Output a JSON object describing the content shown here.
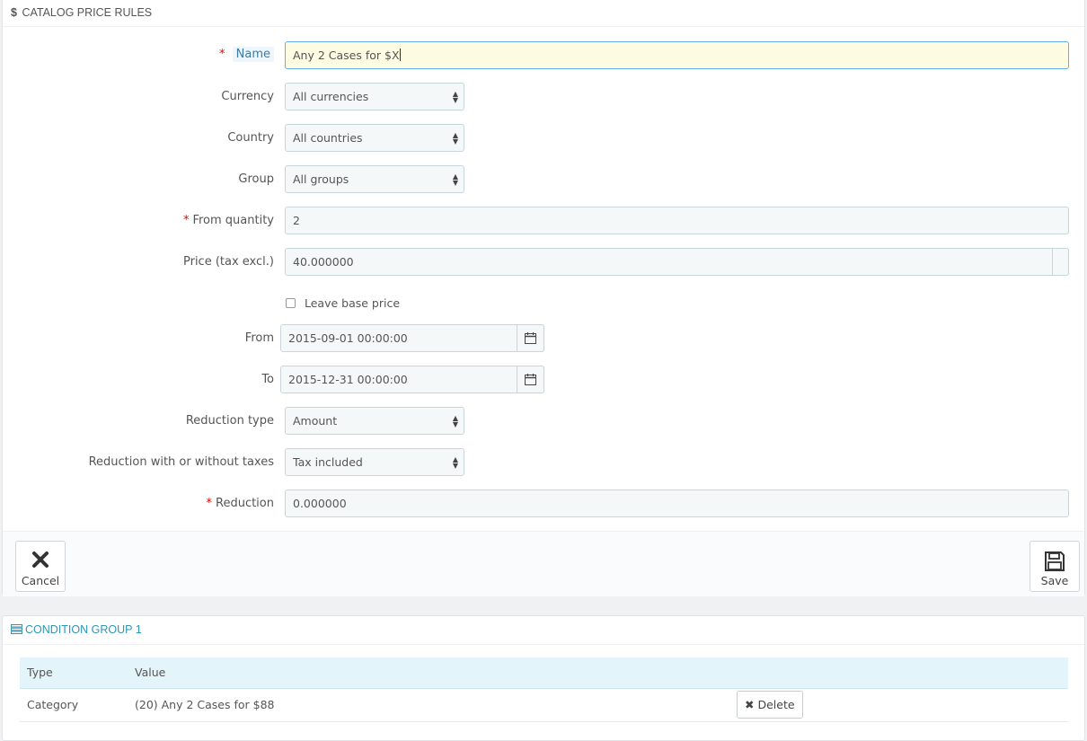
{
  "panel": {
    "title": "Catalog price rules",
    "icon": "dollar-icon"
  },
  "form": {
    "name": {
      "label": "Name",
      "value": "Any 2 Cases for $X",
      "required": true
    },
    "currency": {
      "label": "Currency",
      "value": "All currencies"
    },
    "country": {
      "label": "Country",
      "value": "All countries"
    },
    "group": {
      "label": "Group",
      "value": "All groups"
    },
    "from_quantity": {
      "label": "From quantity",
      "value": "2",
      "required": true
    },
    "price": {
      "label": "Price (tax excl.)",
      "value": "40.000000"
    },
    "leave_base_price": {
      "label": "Leave base price",
      "checked": false
    },
    "from": {
      "label": "From",
      "value": "2015-09-01 00:00:00"
    },
    "to": {
      "label": "To",
      "value": "2015-12-31 00:00:00"
    },
    "reduction_type": {
      "label": "Reduction type",
      "value": "Amount"
    },
    "reduction_tax": {
      "label": "Reduction with or without taxes",
      "value": "Tax included"
    },
    "reduction": {
      "label": "Reduction",
      "value": "0.000000",
      "required": true
    }
  },
  "footer": {
    "cancel_label": "Cancel",
    "save_label": "Save"
  },
  "conditions": {
    "title": "Condition group 1",
    "columns": [
      "Type",
      "Value"
    ],
    "rows": [
      {
        "type": "Category",
        "value": "(20) Any 2 Cases for $88",
        "action": "Delete"
      }
    ]
  },
  "colors": {
    "accent": "#2f96b4",
    "required": "#ee0000",
    "focused_input": "#fefbe3",
    "table_header": "#e3f4fa"
  }
}
